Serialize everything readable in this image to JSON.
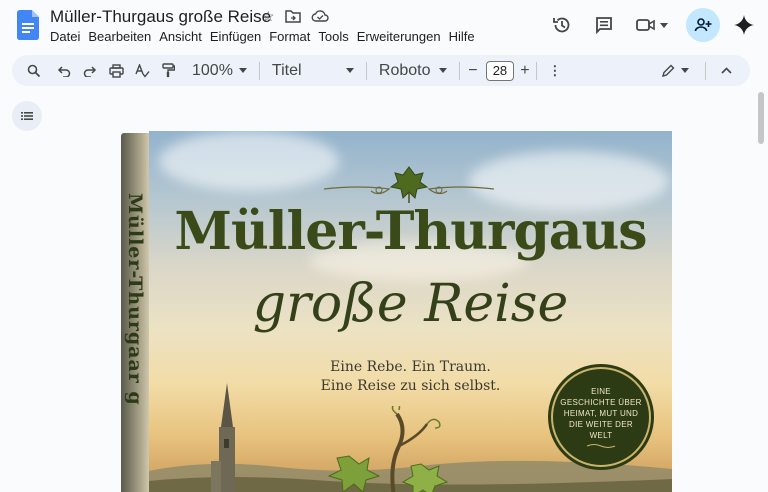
{
  "doc": {
    "title": "Müller-Thurgaus große Reise"
  },
  "menu": [
    "Datei",
    "Bearbeiten",
    "Ansicht",
    "Einfügen",
    "Format",
    "Tools",
    "Erweiterungen",
    "Hilfe"
  ],
  "toolbar": {
    "zoom": "100%",
    "style": "Titel",
    "font": "Roboto",
    "font_size": "28",
    "minus": "−",
    "plus": "+"
  },
  "cover": {
    "spine_text": "Müller-Thurgaar g",
    "title": "Müller-Thurgaus",
    "subtitle": "große Reise",
    "tagline1": "Eine Rebe. Ein Traum.",
    "tagline2": "Eine Reise zu sich selbst.",
    "badge": [
      "EINE",
      "GESCHICHTE ÜBER",
      "HEIMAT, MUT UND",
      "DIE WEITE DER",
      "WELT"
    ]
  },
  "colors": {
    "accent": "#0b57d0",
    "share_bg": "#c2e7ff",
    "toolbar_bg": "#edf2fa",
    "cover_title": "#3a4a18",
    "badge_bg": "#2d3b14"
  },
  "icons": {
    "app": "google-docs-icon",
    "star": "star-icon",
    "move": "move-to-folder-icon",
    "cloud": "cloud-saved-icon",
    "history": "version-history-icon",
    "comments": "comments-icon",
    "meet": "video-call-icon",
    "share": "share-person-icon",
    "gemini": "gemini-sparkle-icon"
  }
}
